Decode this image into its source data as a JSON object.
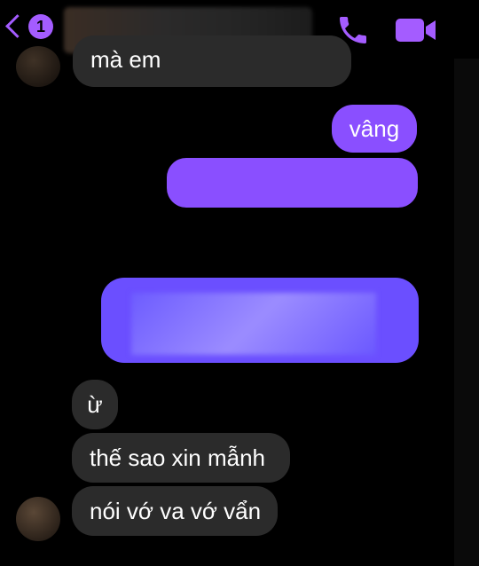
{
  "header": {
    "unread_badge": "1",
    "icons": {
      "back": "chevron-left-icon",
      "call": "phone-icon",
      "video": "video-camera-icon"
    },
    "accent_color": "#a45cff"
  },
  "messages": [
    {
      "id": "m1",
      "side": "received",
      "text": "mà em"
    },
    {
      "id": "m2",
      "side": "sent",
      "text": "vâng"
    },
    {
      "id": "m3",
      "side": "sent",
      "text": ""
    },
    {
      "id": "m4",
      "side": "sent",
      "text": ""
    },
    {
      "id": "m5",
      "side": "received",
      "text": "ừ"
    },
    {
      "id": "m6",
      "side": "received",
      "text": "thế sao xin mẫnh"
    },
    {
      "id": "m7",
      "side": "received",
      "text": "nói vớ va vớ vẩn"
    }
  ],
  "colors": {
    "sent_bubble": "#8a4fff",
    "received_bubble": "#2b2b2b",
    "background": "#000000"
  }
}
